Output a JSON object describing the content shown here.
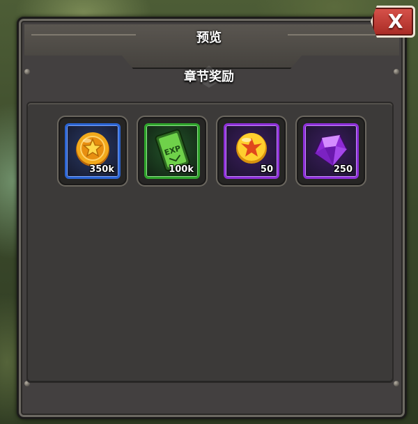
{
  "dialog": {
    "title": "预览",
    "subtitle": "章节奖励",
    "close_label": "X"
  },
  "rewards": [
    {
      "item": "gold-coin",
      "quantity": "350k",
      "rarity": "blue"
    },
    {
      "item": "exp-card",
      "quantity": "100k",
      "rarity": "green"
    },
    {
      "item": "emblem-orb",
      "quantity": "50",
      "rarity": "purple"
    },
    {
      "item": "purple-gem",
      "quantity": "250",
      "rarity": "purple"
    }
  ],
  "colors": {
    "panel": "#434040",
    "rarity_blue": "#2a64d2",
    "rarity_green": "#2fa42c",
    "rarity_purple": "#8d2fd8",
    "close_button": "#c8413a"
  }
}
